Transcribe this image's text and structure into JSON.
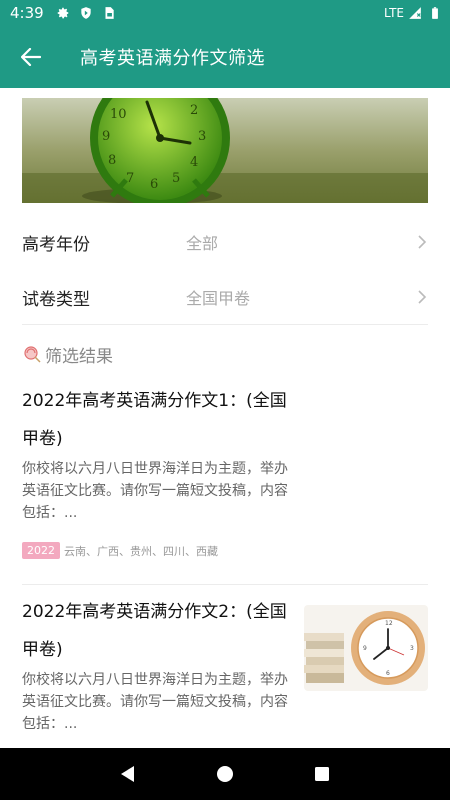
{
  "status_bar": {
    "time": "4:39",
    "network": "LTE",
    "icons": [
      "gear-icon",
      "shield-icon",
      "sim-card-icon",
      "signal-icon",
      "battery-icon"
    ]
  },
  "header": {
    "title": "高考英语满分作文筛选",
    "back_icon": "arrow-left-icon",
    "background_color": "#1f9a85"
  },
  "filters": [
    {
      "label": "高考年份",
      "value": "全部"
    },
    {
      "label": "试卷类型",
      "value": "全国甲卷"
    }
  ],
  "results": {
    "title": "筛选结果",
    "items": [
      {
        "title": "2022年高考英语满分作文1：(全国甲卷)",
        "description": "你校将以六月八日世界海洋日为主题，举办英语征文比赛。请你写一篇短文投稿，内容包括：...",
        "year_tag": "2022",
        "regions": "云南、广西、贵州、四川、西藏"
      },
      {
        "title": "2022年高考英语满分作文2：(全国甲卷)",
        "description": "你校将以六月八日世界海洋日为主题，举办英语征文比赛。请你写一篇短文投稿，内容包括：..."
      }
    ]
  },
  "nav_bar": {
    "icons": [
      "back-triangle-icon",
      "home-circle-icon",
      "recents-square-icon"
    ]
  },
  "colors": {
    "accent": "#1f9a85",
    "tag_bg": "#f3a9bf"
  }
}
